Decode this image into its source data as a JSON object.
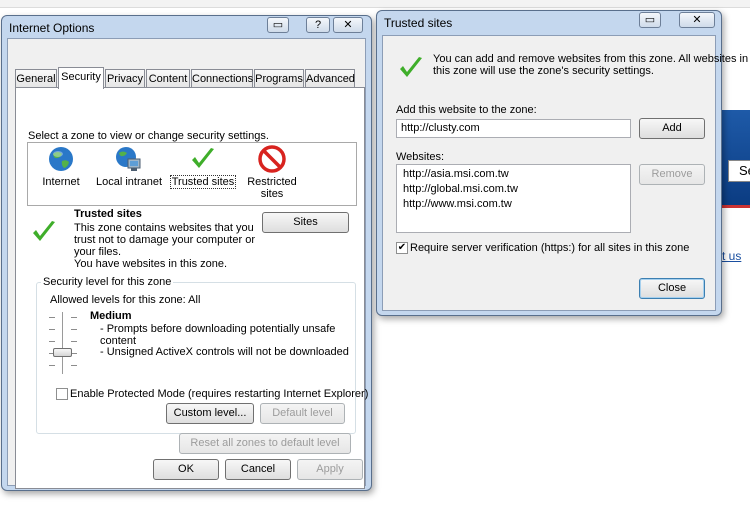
{
  "background": {
    "box_text": "Se",
    "link_text": "ct us"
  },
  "internet_options": {
    "title": "Internet Options",
    "tabs": [
      {
        "label": "General"
      },
      {
        "label": "Security"
      },
      {
        "label": "Privacy"
      },
      {
        "label": "Content"
      },
      {
        "label": "Connections"
      },
      {
        "label": "Programs"
      },
      {
        "label": "Advanced"
      }
    ],
    "active_tab": "Security",
    "zone_prompt": "Select a zone to view or change security settings.",
    "zones": [
      {
        "label": "Internet",
        "icon": "globe-icon"
      },
      {
        "label": "Local intranet",
        "icon": "intranet-icon"
      },
      {
        "label": "Trusted sites",
        "icon": "checkmark-icon"
      },
      {
        "label": "Restricted",
        "label2": "sites",
        "icon": "restricted-icon"
      }
    ],
    "zone_title": "Trusted sites",
    "zone_desc_lines": [
      "This zone contains websites that you",
      "trust not to damage your computer or",
      "your files.",
      "You have websites in this zone."
    ],
    "sites_button": "Sites",
    "security_level_group": "Security level for this zone",
    "allowed_levels": "Allowed levels for this zone: All",
    "level_name": "Medium",
    "level_desc_lines": [
      "- Prompts before downloading potentially unsafe",
      "content",
      "- Unsigned ActiveX controls will not be downloaded"
    ],
    "protected_mode_label": "Enable Protected Mode (requires restarting Internet Explorer)",
    "protected_mode_checked": false,
    "custom_level_button": "Custom level...",
    "default_level_button": "Default level",
    "reset_all_button": "Reset all zones to default level",
    "ok_button": "OK",
    "cancel_button": "Cancel",
    "apply_button": "Apply"
  },
  "trusted_sites": {
    "title": "Trusted sites",
    "info_lines": [
      "You can add and remove websites from this zone. All websites in",
      "this zone will use the zone's security settings."
    ],
    "add_label": "Add this website to the zone:",
    "add_value": "http://clusty.com",
    "add_button": "Add",
    "websites_label": "Websites:",
    "websites": [
      "http://asia.msi.com.tw",
      "http://global.msi.com.tw",
      "http://www.msi.com.tw"
    ],
    "remove_button": "Remove",
    "require_https_label": "Require server verification (https:) for all sites in this zone",
    "require_https_checked": true,
    "close_button": "Close"
  },
  "colors": {
    "titlebar": "#c4d7ee",
    "check_green": "#3fae2a",
    "restricted_red": "#d8231f",
    "globe_blue": "#2a78c8"
  }
}
